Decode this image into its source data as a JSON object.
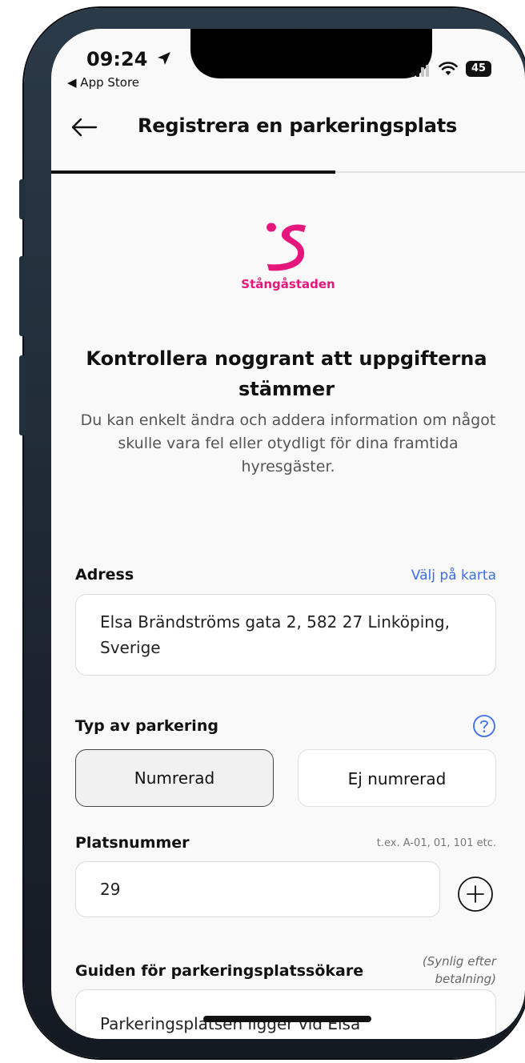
{
  "status_bar": {
    "time": "09:24",
    "back_app": "◀ App Store",
    "battery": "45"
  },
  "header": {
    "title": "Registrera en parkeringsplats",
    "progress": 0.6
  },
  "brand": {
    "name": "Stångåstaden",
    "color": "#e5177d"
  },
  "intro": {
    "heading": "Kontrollera noggrant att uppgifterna stämmer",
    "description": "Du kan enkelt ändra och addera information om något skulle vara fel eller otydligt för dina framtida hyresgäster."
  },
  "address": {
    "label": "Adress",
    "map_link": "Välj på karta",
    "value": "Elsa Brändströms gata 2, 582 27 Linköping, Sverige"
  },
  "parking_type": {
    "label": "Typ av parkering",
    "help_icon": "question-circle-icon",
    "options": [
      "Numrerad",
      "Ej numrerad"
    ],
    "selected": "Numrerad"
  },
  "spot_number": {
    "label": "Platsnummer",
    "hint": "t.ex. A-01, 01, 101 etc.",
    "value": "29",
    "add_icon": "plus-circle-icon"
  },
  "guide": {
    "label": "Guiden för parkeringsplatssökare",
    "visibility_note": "(Synlig efter betalning)",
    "value": "Parkeringsplatsen ligger vid Elsa"
  }
}
